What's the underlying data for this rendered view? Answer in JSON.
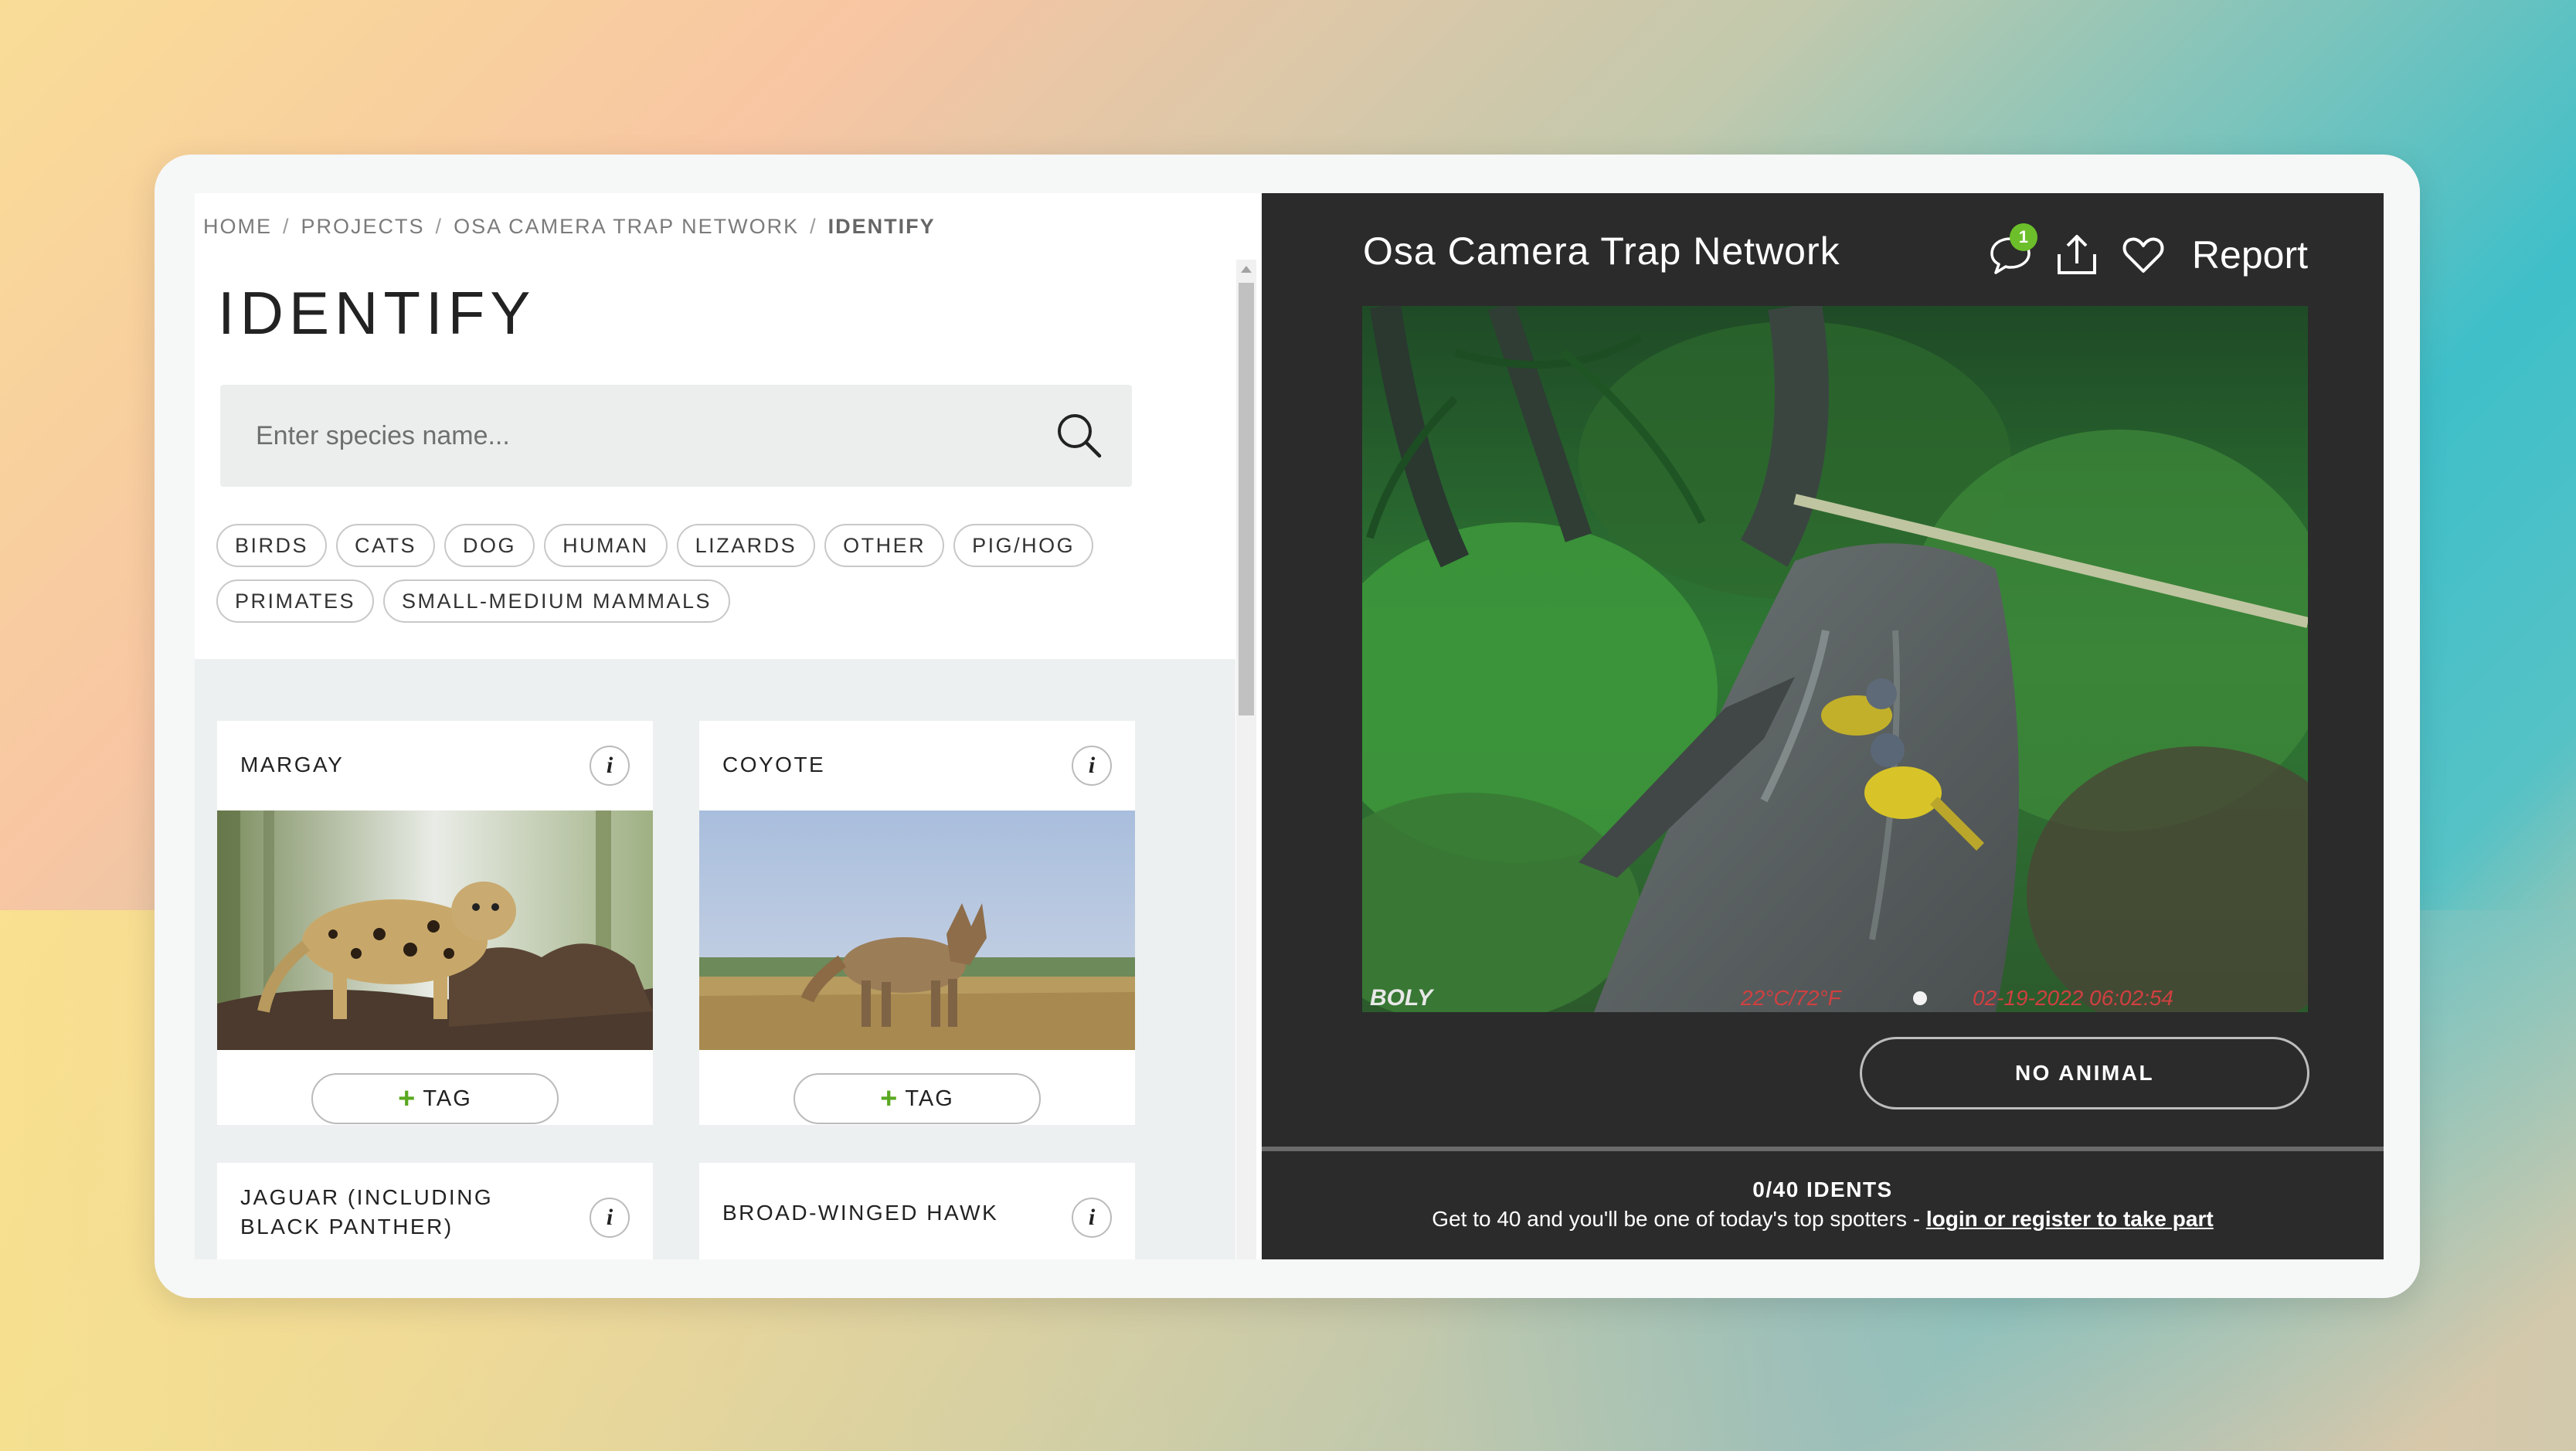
{
  "breadcrumb": {
    "home": "HOME",
    "projects": "PROJECTS",
    "project": "OSA CAMERA TRAP NETWORK",
    "current": "IDENTIFY",
    "separator": "/"
  },
  "page_title": "IDENTIFY",
  "search": {
    "placeholder": "Enter species name...",
    "value": ""
  },
  "filters": [
    "BIRDS",
    "CATS",
    "DOG",
    "HUMAN",
    "LIZARDS",
    "OTHER",
    "PIG/HOG",
    "PRIMATES",
    "SMALL-MEDIUM MAMMALS"
  ],
  "species": [
    {
      "name": "MARGAY",
      "tag_label": "TAG",
      "info_label": "i"
    },
    {
      "name": "COYOTE",
      "tag_label": "TAG",
      "info_label": "i"
    },
    {
      "name": "JAGUAR (INCLUDING BLACK PANTHER)",
      "info_label": "i"
    },
    {
      "name": "BROAD-WINGED HAWK",
      "info_label": "i"
    }
  ],
  "viewer": {
    "project_title": "Osa Camera Trap Network",
    "comment_count": "1",
    "report_label": "Report",
    "camera_overlay": {
      "brand": "BOLY",
      "temperature": "22°C/72°F",
      "datetime": "02-19-2022  06:02:54"
    },
    "no_animal_label": "NO ANIMAL",
    "idents_label": "0/40 IDENTS",
    "prompt_text": "Get to 40 and you'll be one of today's top spotters - ",
    "prompt_link": "login or register to take part"
  },
  "colors": {
    "accent_green": "#6cbf2a",
    "viewer_bg": "#2b2b2b"
  },
  "icons": [
    "search-icon",
    "comment-icon",
    "share-icon",
    "heart-icon",
    "info-icon",
    "plus-icon"
  ]
}
